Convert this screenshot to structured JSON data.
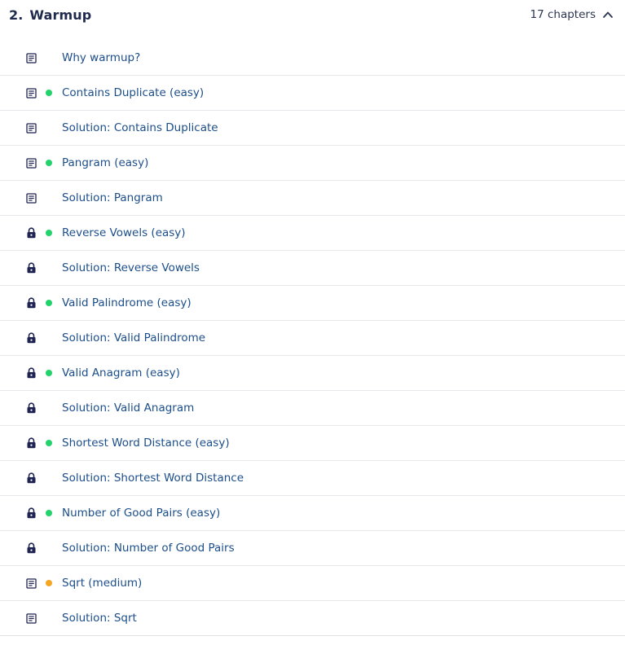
{
  "section": {
    "number": "2.",
    "title": "Warmup",
    "count_label": "17 chapters"
  },
  "colors": {
    "easy": "#22d36b",
    "medium": "#f5a623",
    "link": "#1c4e8a",
    "icon": "#1f2352"
  },
  "chapters": [
    {
      "label": "Why warmup?",
      "icon": "article-icon",
      "difficulty": null
    },
    {
      "label": "Contains Duplicate (easy)",
      "icon": "article-icon",
      "difficulty": "easy"
    },
    {
      "label": "Solution: Contains Duplicate",
      "icon": "article-icon",
      "difficulty": null
    },
    {
      "label": "Pangram (easy)",
      "icon": "article-icon",
      "difficulty": "easy"
    },
    {
      "label": "Solution: Pangram",
      "icon": "article-icon",
      "difficulty": null
    },
    {
      "label": "Reverse Vowels (easy)",
      "icon": "lock-icon",
      "difficulty": "easy"
    },
    {
      "label": "Solution: Reverse Vowels",
      "icon": "lock-icon",
      "difficulty": null
    },
    {
      "label": "Valid Palindrome (easy)",
      "icon": "lock-icon",
      "difficulty": "easy"
    },
    {
      "label": "Solution: Valid Palindrome",
      "icon": "lock-icon",
      "difficulty": null
    },
    {
      "label": "Valid Anagram (easy)",
      "icon": "lock-icon",
      "difficulty": "easy"
    },
    {
      "label": "Solution: Valid Anagram",
      "icon": "lock-icon",
      "difficulty": null
    },
    {
      "label": "Shortest Word Distance (easy)",
      "icon": "lock-icon",
      "difficulty": "easy"
    },
    {
      "label": "Solution: Shortest Word Distance",
      "icon": "lock-icon",
      "difficulty": null
    },
    {
      "label": "Number of Good Pairs (easy)",
      "icon": "lock-icon",
      "difficulty": "easy"
    },
    {
      "label": "Solution: Number of Good Pairs",
      "icon": "lock-icon",
      "difficulty": null
    },
    {
      "label": "Sqrt (medium)",
      "icon": "article-icon",
      "difficulty": "medium"
    },
    {
      "label": "Solution: Sqrt",
      "icon": "article-icon",
      "difficulty": null
    }
  ]
}
